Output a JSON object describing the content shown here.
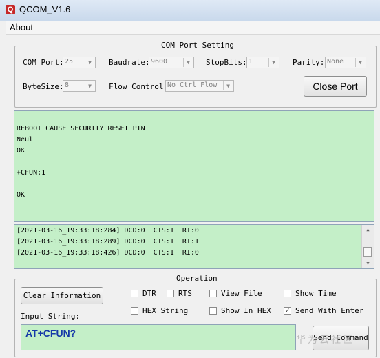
{
  "window": {
    "title": "QCOM_V1.6",
    "app_icon": "Q"
  },
  "menu": {
    "about": "About"
  },
  "com_setting": {
    "group_label": "COM Port Setting",
    "com_port_label": "COM Port:",
    "com_port_value": "25",
    "baudrate_label": "Baudrate:",
    "baudrate_value": "9600",
    "stopbits_label": "StopBits:",
    "stopbits_value": "1",
    "parity_label": "Parity:",
    "parity_value": "None",
    "bytesize_label": "ByteSize:",
    "bytesize_value": "8",
    "flow_label": "Flow Control:",
    "flow_value": "No Ctrl Flow",
    "close_port": "Close Port"
  },
  "receive_log": [
    "",
    "REBOOT_CAUSE_SECURITY_RESET_PIN",
    "Neul",
    "OK",
    "",
    "+CFUN:1",
    "",
    "OK"
  ],
  "status_log": [
    "[2021-03-16_19:33:18:284] DCD:0  CTS:1  RI:0",
    "[2021-03-16_19:33:18:289] DCD:0  CTS:1  RI:1",
    "[2021-03-16_19:33:18:426] DCD:0  CTS:1  RI:0"
  ],
  "operation": {
    "group_label": "Operation",
    "clear_info": "Clear Information",
    "dtr": "DTR",
    "rts": "RTS",
    "view_file": "View File",
    "show_time": "Show Time",
    "hex_string": "HEX String",
    "show_in_hex": "Show In HEX",
    "send_with_enter": "Send With Enter",
    "send_with_enter_checked": true,
    "input_label": "Input String:",
    "input_value": "AT+CFUN?",
    "send_command": "Send Command"
  },
  "watermark": "华为云社区"
}
